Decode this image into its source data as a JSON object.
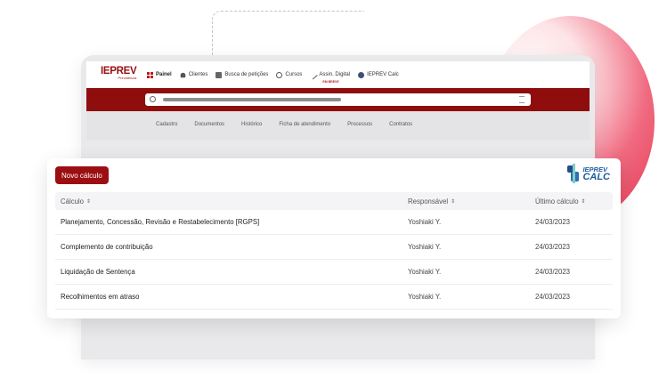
{
  "app": {
    "logo": "IEPREV",
    "logo_sub": "Previdência",
    "nav": [
      {
        "label": "Painel",
        "icon": "dashboard-icon"
      },
      {
        "label": "Clientes",
        "icon": "users-icon"
      },
      {
        "label": "Busca de petições",
        "icon": "document-icon"
      },
      {
        "label": "Cursos",
        "icon": "gear-icon"
      },
      {
        "label": "Assin. Digital",
        "icon": "pen-icon",
        "badge": "EM BREVE"
      },
      {
        "label": "IEPREV Calc",
        "icon": "calc-icon"
      }
    ],
    "subnav": [
      "Cadastro",
      "Documentos",
      "Histórico",
      "Ficha de atendimento",
      "Processos",
      "Contratos"
    ]
  },
  "card": {
    "new_button": "Novo cálculo",
    "logo_top": "IEPREV",
    "logo_bottom": "CALC",
    "columns": [
      "Cálculo",
      "Responsável",
      "Último cálculo"
    ],
    "sort_glyph": "⇕",
    "rows": [
      {
        "calc": "Planejamento, Concessão, Revisão e Restabelecimento [RGPS]",
        "resp": "Yoshiaki Y.",
        "date": "24/03/2023"
      },
      {
        "calc": "Complemento de contribuição",
        "resp": "Yoshiaki Y.",
        "date": "24/03/2023"
      },
      {
        "calc": "Liquidação de Sentença",
        "resp": "Yoshiaki Y.",
        "date": "24/03/2023"
      },
      {
        "calc": "Recolhimentos em atraso",
        "resp": "Yoshiaki Y.",
        "date": "24/03/2023"
      }
    ]
  },
  "colors": {
    "brand_red": "#9b0f12",
    "calc_blue": "#1f5c9e"
  }
}
